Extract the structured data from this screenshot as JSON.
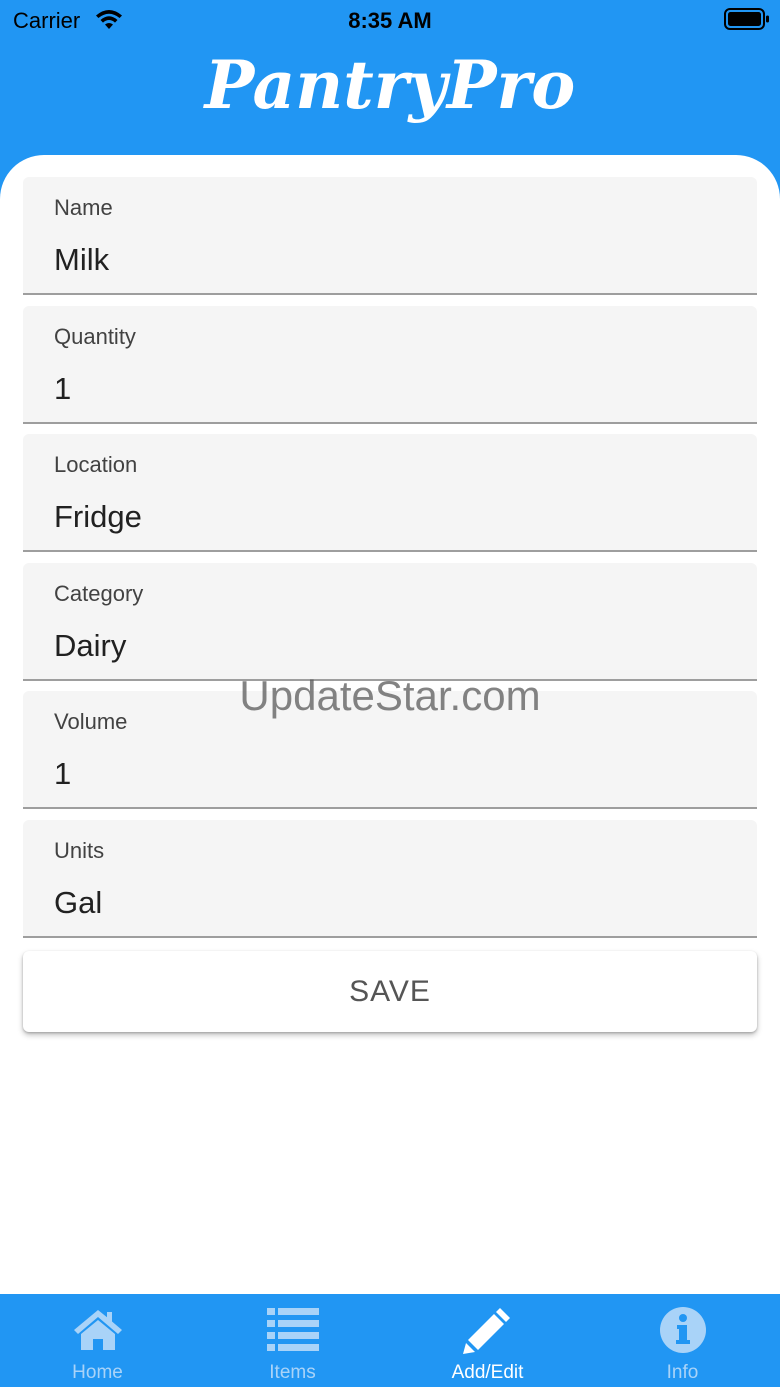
{
  "status_bar": {
    "carrier": "Carrier",
    "time": "8:35 AM"
  },
  "header": {
    "title": "PantryPro"
  },
  "form": {
    "fields": [
      {
        "label": "Name",
        "value": "Milk"
      },
      {
        "label": "Quantity",
        "value": "1"
      },
      {
        "label": "Location",
        "value": "Fridge"
      },
      {
        "label": "Category",
        "value": "Dairy"
      },
      {
        "label": "Volume",
        "value": "1"
      },
      {
        "label": "Units",
        "value": "Gal"
      }
    ],
    "save_label": "SAVE"
  },
  "watermark": "UpdateStar.com",
  "tab_bar": {
    "tabs": [
      {
        "label": "Home",
        "icon": "home-icon"
      },
      {
        "label": "Items",
        "icon": "list-icon"
      },
      {
        "label": "Add/Edit",
        "icon": "pencil-icon",
        "active": true
      },
      {
        "label": "Info",
        "icon": "info-icon"
      }
    ]
  },
  "colors": {
    "primary": "#2196F3",
    "field_background": "#f5f5f5",
    "inactive_tab": "#a9d3f8"
  }
}
